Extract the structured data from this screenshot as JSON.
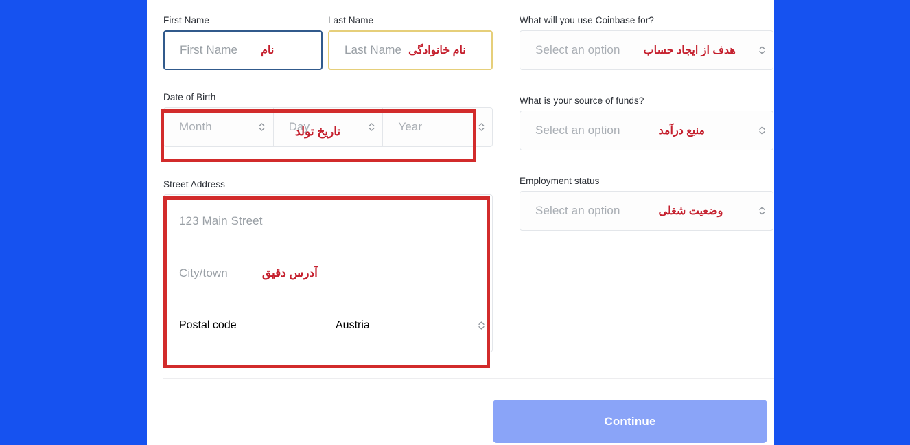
{
  "theme": {
    "page_background": "#1652f0",
    "card_background": "#ffffff",
    "annotation_color": "#c5202e",
    "annotation_box_color": "#d22b2b",
    "continue_button_color": "#8aa4f8",
    "first_name_border": "#315a8c",
    "last_name_border": "#e6cf7a"
  },
  "form": {
    "left_column": {
      "first_name": {
        "label": "First Name",
        "placeholder": "First Name",
        "annotation_fa": "نام"
      },
      "last_name": {
        "label": "Last Name",
        "placeholder": "Last Name",
        "annotation_fa": "نام خانوادگی"
      },
      "date_of_birth": {
        "label": "Date of Birth",
        "month_placeholder": "Month",
        "day_placeholder": "Day",
        "year_placeholder": "Year",
        "annotation_fa": "تاریخ تولد"
      },
      "street_address": {
        "label": "Street Address",
        "street_placeholder": "123 Main Street",
        "city_placeholder": "City/town",
        "postal_placeholder": "Postal code",
        "country_value": "Austria",
        "annotation_fa": "آدرس دقیق"
      }
    },
    "right_column": {
      "use_for": {
        "label": "What will you use Coinbase for?",
        "placeholder": "Select an option",
        "annotation_fa": "هدف از ایجاد حساب"
      },
      "source_of_funds": {
        "label": "What is your source of funds?",
        "placeholder": "Select an option",
        "annotation_fa": "منبع درآمد"
      },
      "employment_status": {
        "label": "Employment status",
        "placeholder": "Select an option",
        "annotation_fa": "وضعیت شغلی"
      }
    }
  },
  "footer": {
    "continue_label": "Continue"
  },
  "icons": {
    "stepper": "chevron-up-down-icon"
  }
}
